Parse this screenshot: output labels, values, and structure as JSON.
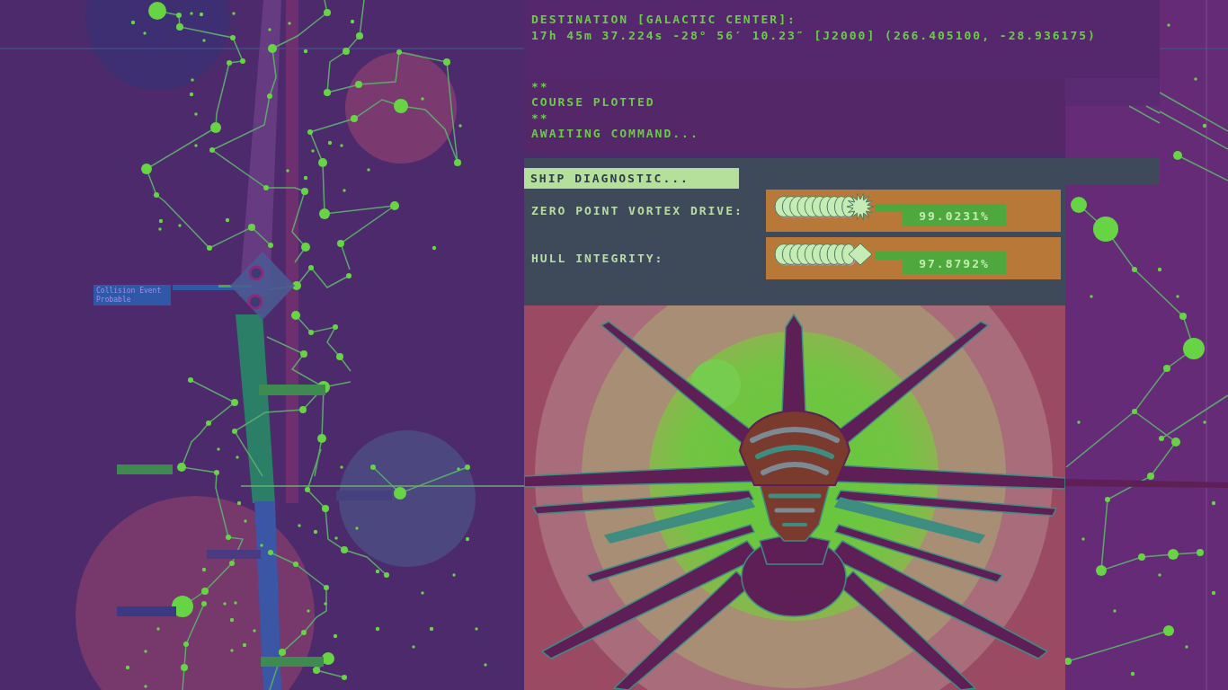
{
  "console": {
    "destination": {
      "heading": "DESTINATION [GALACTIC CENTER]:",
      "coordinates": "17h 45m 37.224s -28° 56′ 10.23″ [J2000] (266.405100, -28.936175)"
    },
    "log": [
      "**",
      "COURSE PLOTTED",
      "**",
      "AWAITING COMMAND..."
    ]
  },
  "diagnostic": {
    "title": "SHIP DIAGNOSTIC...",
    "systems": [
      {
        "label": "ZERO POINT VORTEX DRIVE:",
        "kind": "burst",
        "reading": "99.0231%"
      },
      {
        "label": "HULL INTEGRITY:",
        "kind": "diamond",
        "reading": "97.8792%"
      }
    ]
  },
  "star_map": {
    "labels": [
      {
        "text": "Collision Event Probable"
      }
    ]
  }
}
